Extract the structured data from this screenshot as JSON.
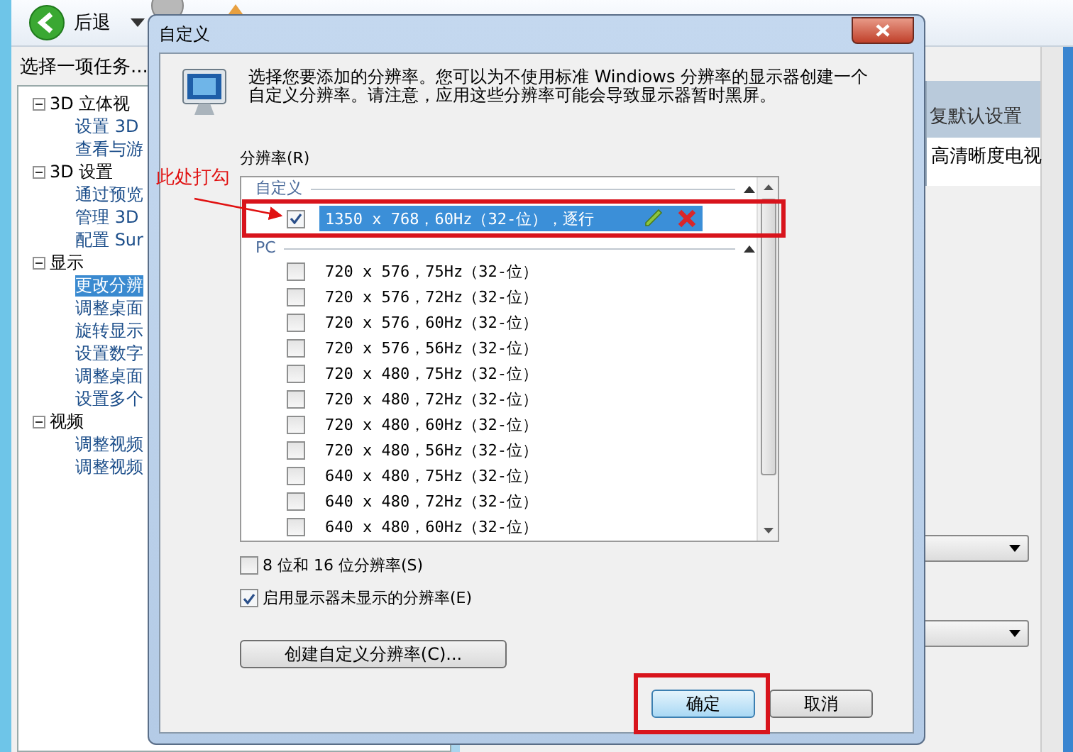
{
  "toolbar": {
    "back_label": "后退"
  },
  "sidebar": {
    "title": "选择一项任务...",
    "tree": [
      {
        "label": "3D 立体视",
        "expanded": true,
        "children": [
          {
            "label": "设置 3D",
            "selected": false
          },
          {
            "label": "查看与游",
            "selected": false
          }
        ]
      },
      {
        "label": "3D 设置",
        "expanded": true,
        "children": [
          {
            "label": "通过预览",
            "selected": false
          },
          {
            "label": "管理 3D",
            "selected": false
          },
          {
            "label": "配置 Sur",
            "selected": false
          }
        ]
      },
      {
        "label": "显示",
        "expanded": true,
        "children": [
          {
            "label": "更改分辨",
            "selected": true
          },
          {
            "label": "调整桌面",
            "selected": false
          },
          {
            "label": "旋转显示",
            "selected": false
          },
          {
            "label": "设置数字",
            "selected": false
          },
          {
            "label": "调整桌面",
            "selected": false
          },
          {
            "label": "设置多个",
            "selected": false
          }
        ]
      },
      {
        "label": "视频",
        "expanded": true,
        "children": [
          {
            "label": "调整视频",
            "selected": false
          },
          {
            "label": "调整视频",
            "selected": false
          }
        ]
      }
    ]
  },
  "content": {
    "header": "复默认设置",
    "row": "高清晰度电视"
  },
  "dialog": {
    "title": "自定义",
    "description": "选择您要添加的分辨率。您可以为不使用标准 Windiows 分辨率的显示器创建一个自定义分辨率。请注意，应用这些分辨率可能会导致显示器暂时黑屏。",
    "list_label": "分辨率(R)",
    "groups": [
      {
        "name": "自定义",
        "expanded": true,
        "rows": [
          {
            "label": "1350 x 768，60Hz（32-位），逐行",
            "checked": true,
            "selected": true,
            "editable": true
          }
        ]
      },
      {
        "name": "PC",
        "expanded": true,
        "rows": [
          {
            "label": "720 x 576，75Hz（32-位）",
            "checked": false,
            "selected": false,
            "editable": false
          },
          {
            "label": "720 x 576，72Hz（32-位）",
            "checked": false,
            "selected": false,
            "editable": false
          },
          {
            "label": "720 x 576，60Hz（32-位）",
            "checked": false,
            "selected": false,
            "editable": false
          },
          {
            "label": "720 x 576，56Hz（32-位）",
            "checked": false,
            "selected": false,
            "editable": false
          },
          {
            "label": "720 x 480，75Hz（32-位）",
            "checked": false,
            "selected": false,
            "editable": false
          },
          {
            "label": "720 x 480，72Hz（32-位）",
            "checked": false,
            "selected": false,
            "editable": false
          },
          {
            "label": "720 x 480，60Hz（32-位）",
            "checked": false,
            "selected": false,
            "editable": false
          },
          {
            "label": "720 x 480，56Hz（32-位）",
            "checked": false,
            "selected": false,
            "editable": false
          },
          {
            "label": "640 x 480，75Hz（32-位）",
            "checked": false,
            "selected": false,
            "editable": false
          },
          {
            "label": "640 x 480，72Hz（32-位）",
            "checked": false,
            "selected": false,
            "editable": false
          },
          {
            "label": "640 x 480，60Hz（32-位）",
            "checked": false,
            "selected": false,
            "editable": false
          }
        ]
      }
    ],
    "options": [
      {
        "label": "8 位和 16 位分辨率(S)",
        "checked": false
      },
      {
        "label": "启用显示器未显示的分辨率(E)",
        "checked": true
      }
    ],
    "create_button": "创建自定义分辨率(C)...",
    "buttons": [
      {
        "label": "确定",
        "default": true
      },
      {
        "label": "取消",
        "default": false
      }
    ]
  },
  "annotation": {
    "text": "此处打勾"
  }
}
